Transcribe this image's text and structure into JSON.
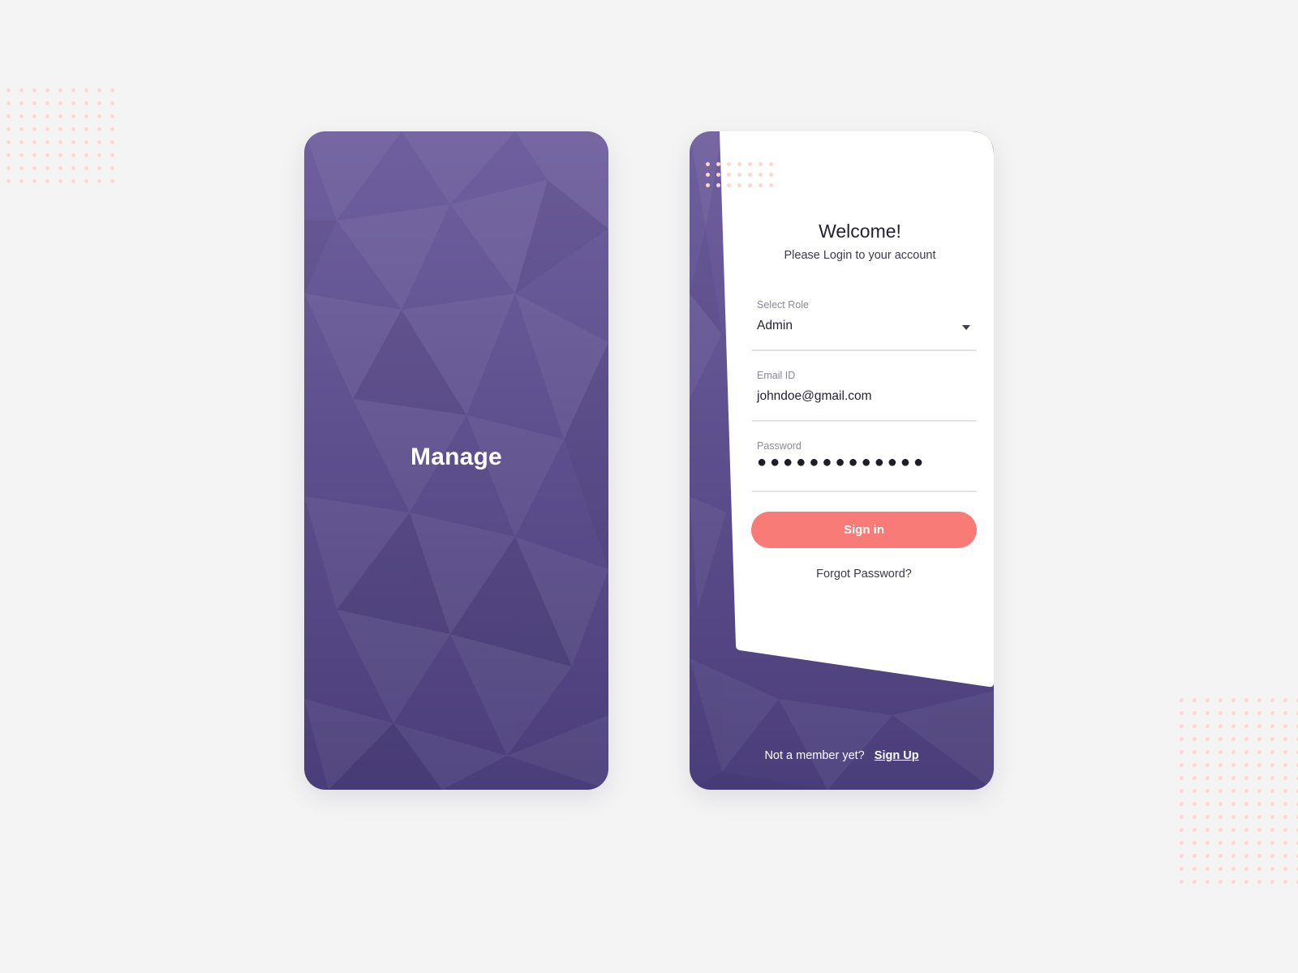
{
  "splash": {
    "title": "Manage"
  },
  "login": {
    "title": "Welcome!",
    "subtitle": "Please Login to your account",
    "role": {
      "label": "Select Role",
      "value": "Admin"
    },
    "email": {
      "label": "Email ID",
      "value": "johndoe@gmail.com"
    },
    "password": {
      "label": "Password",
      "value": "●●●●●●●●●●●●●"
    },
    "signin_label": "Sign in",
    "forgot_label": "Forgot Password?",
    "footer_text": "Not a member yet?",
    "signup_label": "Sign Up"
  },
  "colors": {
    "background": "#f4f4f4",
    "purple_top": "#6f5f9e",
    "purple_bottom": "#4a3e7a",
    "accent": "#f87b78",
    "dots": "#fbd9d2"
  }
}
